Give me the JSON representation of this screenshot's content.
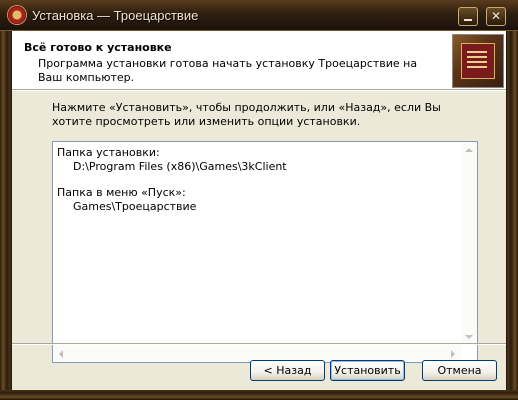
{
  "window": {
    "title": "Установка — Троецарствие",
    "minimize_glyph": "?",
    "close_glyph": "✕"
  },
  "header": {
    "title": "Всё готово к установке",
    "subtitle": "Программа установки готова начать установку Троецарствие на Ваш компьютер."
  },
  "instructions": "Нажмите «Установить», чтобы продолжить, или «Назад», если Вы хотите просмотреть или изменить опции установки.",
  "memo": {
    "dir_label": "Папка установки:",
    "dir_value": "D:\\Program Files (x86)\\Games\\3kClient",
    "start_label": "Папка в меню «Пуск»:",
    "start_value": "Games\\Троецарствие"
  },
  "buttons": {
    "back": "< Назад",
    "install": "Установить",
    "cancel": "Отмена"
  },
  "icons": [
    "app-emblem-icon",
    "book-cover-icon",
    "minimize-icon",
    "close-icon"
  ],
  "colors": {
    "frame": "#3a2a18",
    "dialog_bg": "#ece9d8",
    "header_bg": "#ffffff",
    "button_border": "#003c74"
  }
}
